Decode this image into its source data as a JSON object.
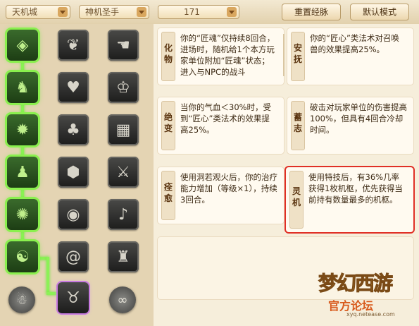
{
  "toolbar": {
    "faction": "天机城",
    "school": "神机圣手",
    "level": "171",
    "reset_button": "重置经脉",
    "default_button": "默认模式"
  },
  "skill_tree": {
    "column1": [
      "gem-icon",
      "beast-icon",
      "sun-icon",
      "warrior-icon",
      "web-icon",
      "swirl-icon"
    ],
    "column2": [
      "leaf-flame-icon",
      "heart-face-icon",
      "tree-icon",
      "shield-icon",
      "eye-icon",
      "spiral-icon"
    ],
    "column3": [
      "hand-icon",
      "bell-icon",
      "wall-icon",
      "swords-icon",
      "horn-icon",
      "robot-icon"
    ],
    "bottom": [
      "ghost-icon",
      "device-icon",
      "serpent-icon"
    ]
  },
  "cards": [
    {
      "tag": "化物",
      "text": "你的“匠魂”仅持续8回合，进场时，随机给1个本方玩家单位附加“匠魂”状态；进入与NPC的战斗"
    },
    {
      "tag": "安抚",
      "text": "你的“匠心”类法术对召唤兽的效果提高25%。"
    },
    {
      "tag": "绝变",
      "text": "当你的气血＜30%时，受到“匠心”类法术的效果提高25%。"
    },
    {
      "tag": "蓄志",
      "text": "破击对玩家单位的伤害提高100%，但具有4回合冷却时间。"
    },
    {
      "tag": "痊愈",
      "text": "使用洞若观火后，你的治疗能力增加（等级×1），持续3回合。"
    },
    {
      "tag": "灵机",
      "text": "使用特技后，有36%几率获得1枚机枢，优先获得当前持有数量最多的机枢。"
    }
  ],
  "logo": {
    "main": "梦幻西游",
    "sub": "官方论坛",
    "url": "xyq.netease.com"
  },
  "colors": {
    "active_glow": "#8af04e",
    "highlight_border": "#e02f25"
  }
}
